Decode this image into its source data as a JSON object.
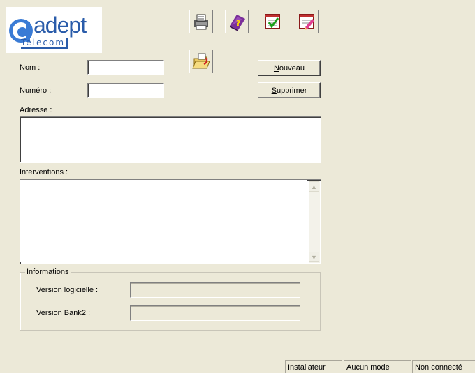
{
  "logo": {
    "brand_main": "adept",
    "brand_sub": "Telecom"
  },
  "toolbar": [
    {
      "name": "print-icon"
    },
    {
      "name": "help-book-icon"
    },
    {
      "name": "check-list-icon"
    },
    {
      "name": "edit-list-icon"
    }
  ],
  "toolbar2": {
    "name": "open-folder-icon"
  },
  "form": {
    "nom_label": "Nom :",
    "nom_value": "",
    "numero_label": "Numéro :",
    "numero_value": "",
    "adresse_label": "Adresse :",
    "adresse_value": "",
    "interventions_label": "Interventions :",
    "interventions_value": ""
  },
  "buttons": {
    "nouveau_first": "N",
    "nouveau_rest": "ouveau",
    "supprimer_first": "S",
    "supprimer_rest": "upprimer"
  },
  "informations": {
    "title": "Informations",
    "version_logicielle_label": "Version logicielle :",
    "version_logicielle_value": "",
    "version_bank2_label": "Version Bank2 :",
    "version_bank2_value": ""
  },
  "statusbar": {
    "role": "Installateur",
    "mode": "Aucun mode",
    "connection": "Non connecté"
  },
  "colors": {
    "window_bg": "#ECE9D8",
    "logo_blue": "#2a5caa"
  }
}
